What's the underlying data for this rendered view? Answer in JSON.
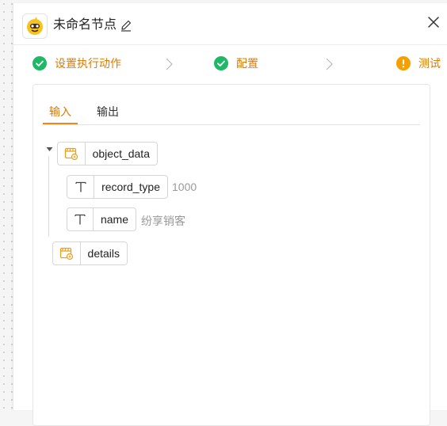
{
  "header": {
    "title": "未命名节点"
  },
  "steps": [
    {
      "label": "设置执行动作",
      "status": "done"
    },
    {
      "label": "配置",
      "status": "done"
    },
    {
      "label": "测试",
      "status": "warning"
    }
  ],
  "tabs": {
    "input": "输入",
    "output": "输出",
    "active": "输入"
  },
  "tree": {
    "root": {
      "label": "object_data"
    },
    "children": [
      {
        "label": "record_type",
        "value": "1000"
      },
      {
        "label": "name",
        "value": "纷享销客"
      }
    ],
    "sibling": {
      "label": "details"
    }
  },
  "colors": {
    "accent": "#e07a00",
    "success": "#1fb866",
    "warning": "#f4a100"
  }
}
